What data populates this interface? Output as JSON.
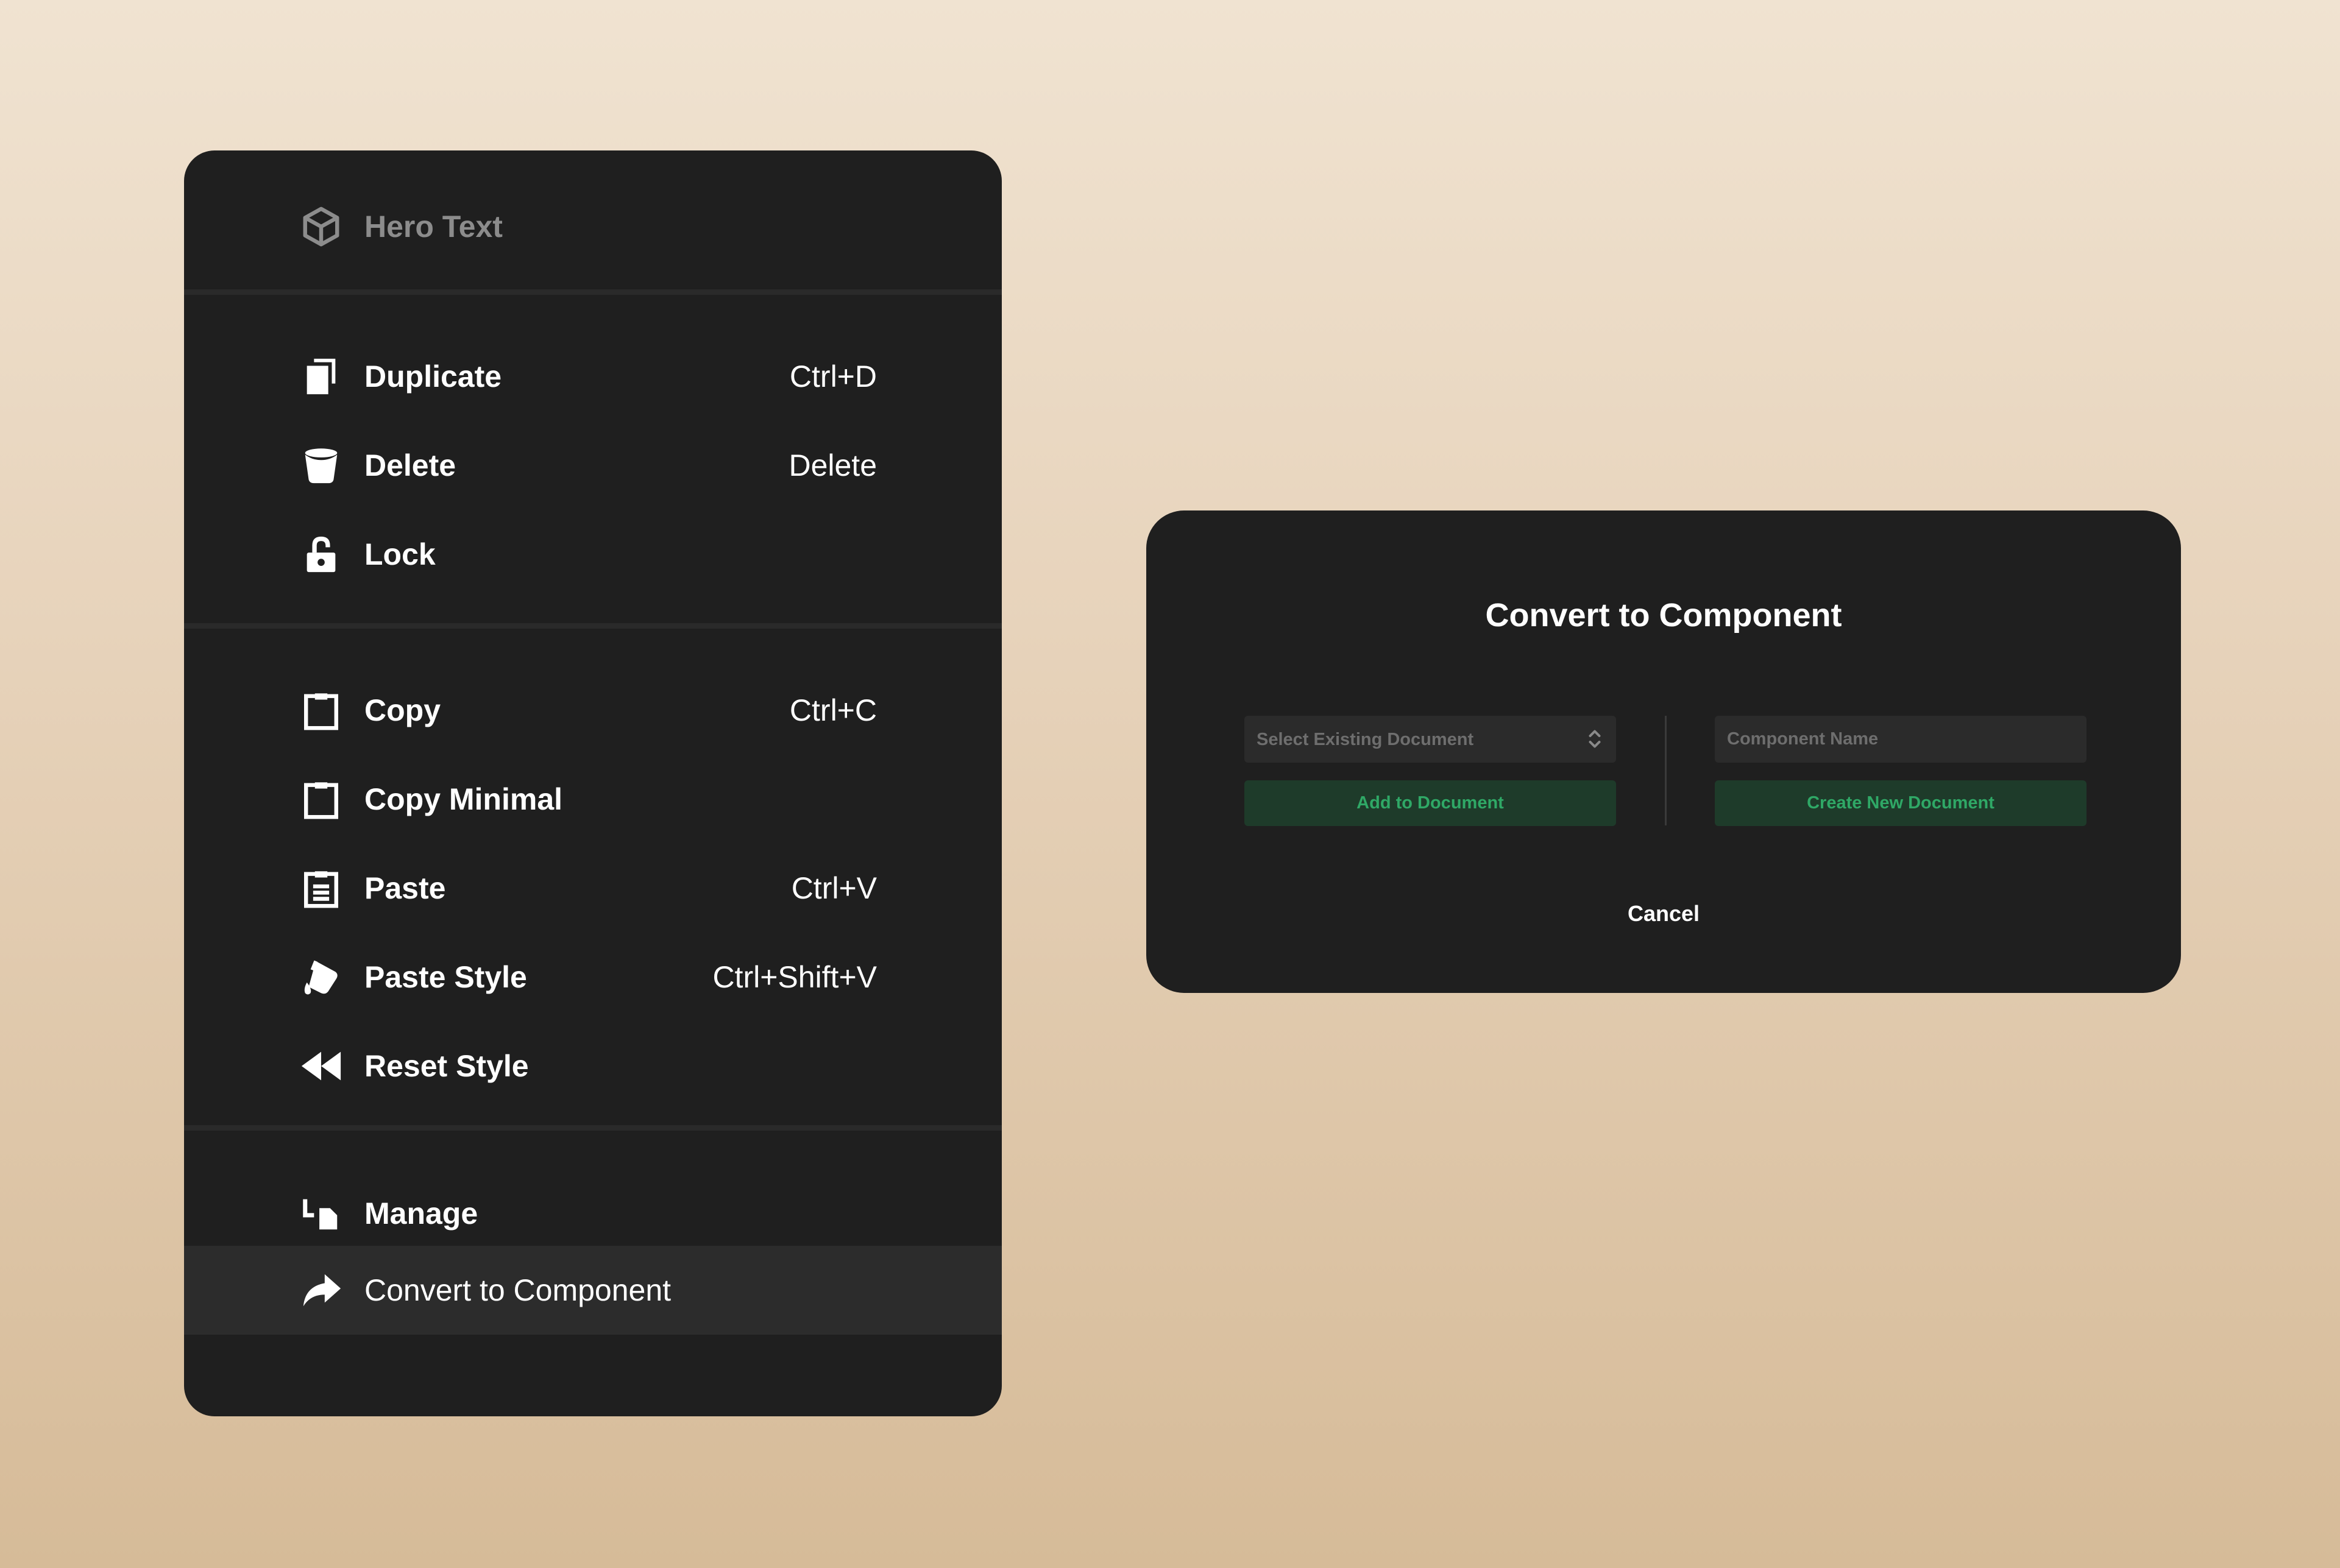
{
  "context_menu": {
    "header": {
      "label": "Hero Text",
      "icon": "cube-icon"
    },
    "items": [
      {
        "label": "Duplicate",
        "shortcut": "Ctrl+D",
        "icon": "duplicate-icon"
      },
      {
        "label": "Delete",
        "shortcut": "Delete",
        "icon": "trash-icon"
      },
      {
        "label": "Lock",
        "shortcut": "",
        "icon": "lock-icon"
      },
      {
        "label": "Copy",
        "shortcut": "Ctrl+C",
        "icon": "clipboard-icon"
      },
      {
        "label": "Copy Minimal",
        "shortcut": "",
        "icon": "clipboard-icon"
      },
      {
        "label": "Paste",
        "shortcut": "Ctrl+V",
        "icon": "paste-icon"
      },
      {
        "label": "Paste Style",
        "shortcut": "Ctrl+Shift+V",
        "icon": "paint-bucket-icon"
      },
      {
        "label": "Reset Style",
        "shortcut": "",
        "icon": "rewind-icon"
      },
      {
        "label": "Manage",
        "shortcut": "",
        "icon": "manage-icon"
      },
      {
        "label": "Convert to Component",
        "shortcut": "",
        "icon": "share-arrow-icon",
        "active": true
      }
    ]
  },
  "dialog": {
    "title": "Convert to Component",
    "select_placeholder": "Select Existing Document",
    "name_placeholder": "Component Name",
    "add_button": "Add to Document",
    "create_button": "Create New Document",
    "cancel": "Cancel"
  },
  "colors": {
    "panel": "#1f1f1f",
    "active_row": "#2c2c2c",
    "green_button_bg": "#1e3b2a",
    "green_button_text": "#2fa866"
  }
}
